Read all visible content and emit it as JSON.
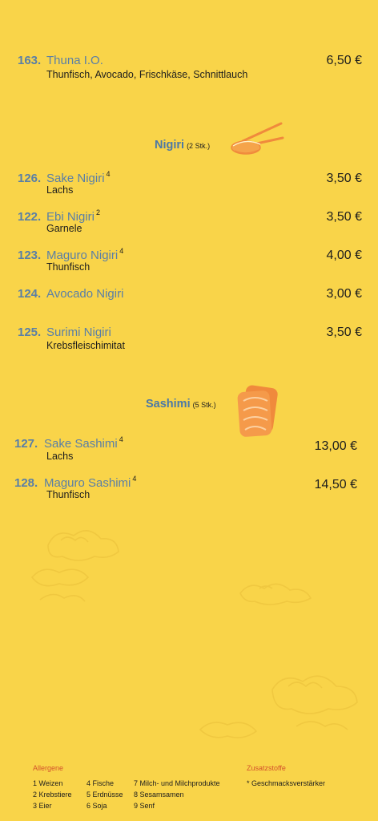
{
  "items_top": [
    {
      "number": "163.",
      "name": "Thuna I.O.",
      "sup": "",
      "desc": "Thunfisch, Avocado, Frischkäse, Schnittlauch",
      "price": "6,50 €"
    }
  ],
  "nigiri": {
    "title": "Nigiri",
    "subtitle": "(2 Stk.)",
    "items": [
      {
        "number": "126.",
        "name": "Sake Nigiri",
        "sup": "4",
        "desc": "Lachs",
        "price": "3,50 €"
      },
      {
        "number": "122.",
        "name": "Ebi Nigiri",
        "sup": "2",
        "desc": "Garnele",
        "price": "3,50 €"
      },
      {
        "number": "123.",
        "name": "Maguro Nigiri",
        "sup": "4",
        "desc": "Thunfisch",
        "price": "4,00 €"
      },
      {
        "number": "124.",
        "name": "Avocado Nigiri",
        "sup": "",
        "desc": "",
        "price": "3,00 €"
      },
      {
        "number": "125.",
        "name": "Surimi Nigiri",
        "sup": "",
        "desc": "Krebsfleischimitat",
        "price": "3,50 €"
      }
    ]
  },
  "sashimi": {
    "title": "Sashimi",
    "subtitle": "(5 Stk.)",
    "items": [
      {
        "number": "127.",
        "name": "Sake Sashimi",
        "sup": "4",
        "desc": "Lachs",
        "price": "13,00 €"
      },
      {
        "number": "128.",
        "name": "Maguro Sashimi",
        "sup": "4",
        "desc": "Thunfisch",
        "price": "14,50 €"
      }
    ]
  },
  "legend": {
    "allergene_title": "Allergene",
    "zusatz_title": "Zusatzstoffe",
    "col1": [
      "1  Weizen",
      "2  Krebstiere",
      "3  Eier"
    ],
    "col2": [
      "4 Fische",
      "5 Erdnüsse",
      "6 Soja"
    ],
    "col3": [
      "7 Milch- und Milchprodukte",
      "8 Sesamsamen",
      "9 Senf"
    ],
    "zusatz": [
      "* Geschmacksverstärker"
    ]
  },
  "colors": {
    "background": "#f9d449",
    "accent": "#5a7fa6",
    "legend_head": "#d4542c",
    "salmon": "#f08a3c"
  },
  "icons": [
    "nigiri-chopsticks-icon",
    "sashimi-salmon-icon",
    "cloud-ornament-icon"
  ]
}
